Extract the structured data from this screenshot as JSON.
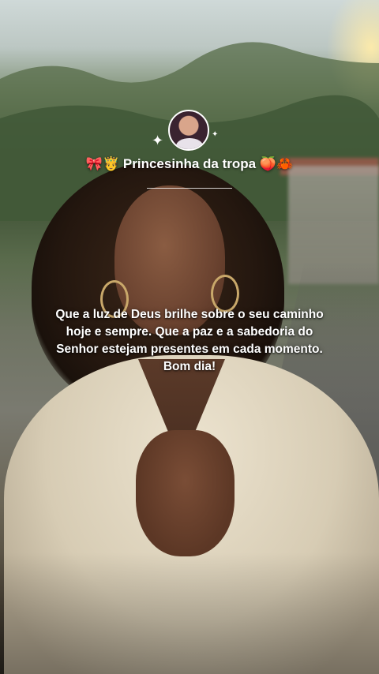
{
  "post": {
    "username": "🎀🤴 Princesinha da tropa 🍑🦀",
    "caption": "Que a luz de Deus brilhe sobre o seu caminho hoje e sempre. Que a paz e a sabedoria do Senhor estejam presentes em cada momento. Bom dia!"
  },
  "icons": {
    "sparkle_large": "✦",
    "sparkle_small": "✦"
  },
  "colors": {
    "text": "#ffffff",
    "divider": "#ffffff"
  }
}
